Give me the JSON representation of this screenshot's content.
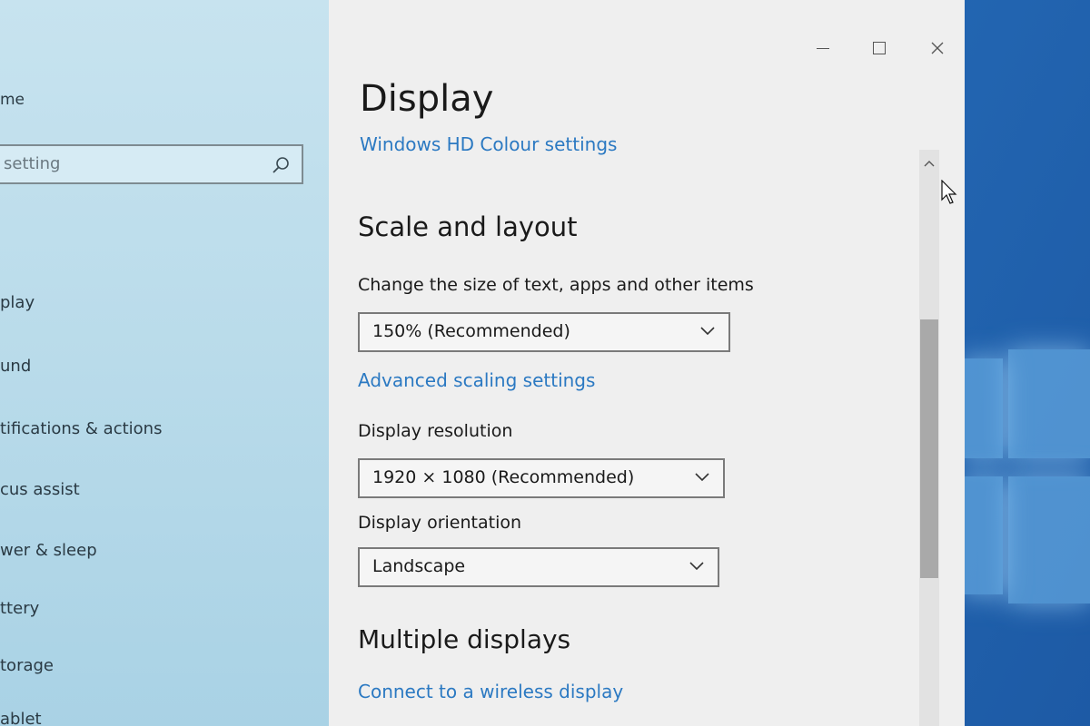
{
  "window": {
    "controls": {
      "minimize": "minimize",
      "maximize": "maximize",
      "close": "close"
    }
  },
  "sidebar": {
    "home_label": "me",
    "search": {
      "placeholder": "setting"
    },
    "items": [
      {
        "label": "play"
      },
      {
        "label": "und"
      },
      {
        "label": "tifications & actions"
      },
      {
        "label": "cus assist"
      },
      {
        "label": "wer & sleep"
      },
      {
        "label": "ttery"
      },
      {
        "label": "torage"
      },
      {
        "label": "ablet"
      }
    ]
  },
  "content": {
    "title": "Display",
    "hd_colour_link": "Windows HD Colour settings",
    "scale_section": {
      "title": "Scale and layout",
      "size_label": "Change the size of text, apps and other items",
      "size_value": "150% (Recommended)",
      "advanced_link": "Advanced scaling settings",
      "resolution_label": "Display resolution",
      "resolution_value": "1920 × 1080 (Recommended)",
      "orientation_label": "Display orientation",
      "orientation_value": "Landscape"
    },
    "multiple_section": {
      "title": "Multiple displays",
      "wireless_link": "Connect to a wireless display"
    }
  },
  "icons": {
    "search": "search-icon",
    "chevron": "chevron-down-icon",
    "scroll_up": "chevron-up-icon",
    "cursor": "mouse-pointer-icon"
  },
  "colors": {
    "accent_link": "#2b79c2",
    "sidebar_bg": "#b9dbea",
    "content_bg": "#efefef",
    "desktop_bg": "#2468b4"
  }
}
